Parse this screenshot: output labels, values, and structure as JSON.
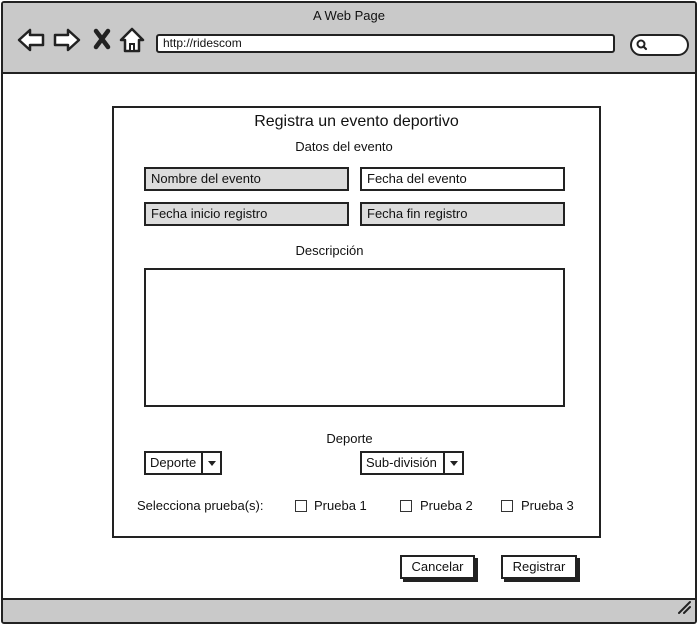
{
  "browser": {
    "title": "A Web Page",
    "url": "http://ridescom"
  },
  "form": {
    "heading": "Registra un evento deportivo",
    "section_label": "Datos del evento",
    "fields": {
      "event_name": "Nombre del evento",
      "event_date": "Fecha del evento",
      "registration_start": "Fecha inicio registro",
      "registration_end": "Fecha fin registro"
    },
    "description_label": "Descripción",
    "sport_label": "Deporte",
    "sport_select": "Deporte",
    "subdivision_select": "Sub-división",
    "tests_label": "Selecciona prueba(s):",
    "tests": [
      "Prueba 1",
      "Prueba 2",
      "Prueba 3"
    ]
  },
  "actions": {
    "cancel": "Cancelar",
    "submit": "Registrar"
  }
}
